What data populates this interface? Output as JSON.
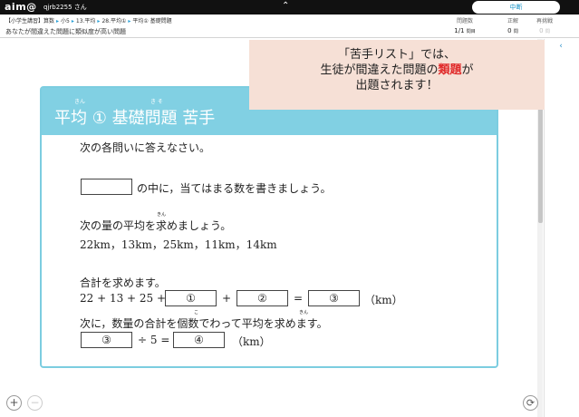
{
  "topbar": {
    "logo": "aim@",
    "user": "qjrb2255 さん",
    "pause_label": "中断"
  },
  "breadcrumb": [
    "【小学生講習】算数",
    "小5",
    "13.平均",
    "28.平均①",
    "平均① 基礎問題"
  ],
  "subtitle": "あなたが間違えた問題に類似度が高い問題",
  "stats": {
    "asked": {
      "label": "問題数",
      "value": "1/1",
      "unit": "問目"
    },
    "correct": {
      "label": "正解",
      "value": "0",
      "unit": "問"
    },
    "retry": {
      "label": "再挑戦",
      "value": "0",
      "unit": "問"
    }
  },
  "callout": {
    "line1": "「苦手リスト」では、",
    "line2_pre": "生徒が間違えた問題の",
    "line2_hl": "類題",
    "line2_post": "が",
    "line3": "出題されます！"
  },
  "card": {
    "title": "平均 ① 基礎問題 苦手",
    "ruby_heikin": "きん",
    "ruby_kiso": "き そ",
    "intro": "次の各問いに答えなさい。",
    "fill_text": "の中に，当てはまる数を書きましょう。",
    "q1": "次の量の平均を求めましょう。",
    "ruby_kin": "きん",
    "values": "22km，13km，25km，11km，14km",
    "sum_label": "合計を求めます。",
    "sum_expr": "22 + 13 + 25 +",
    "plus": "+",
    "eq": "=",
    "unit_km": "（km）",
    "next_text": "次に，数量の合計を個数でわって平均を求めます。",
    "ruby_ko": "こ",
    "div_expr": "÷ 5 =",
    "blanks": [
      "①",
      "②",
      "③",
      "③",
      "④"
    ]
  },
  "controls": {
    "zoom_in": "+",
    "zoom_out": "−",
    "reset": "⟳",
    "side_arrow": "‹"
  }
}
